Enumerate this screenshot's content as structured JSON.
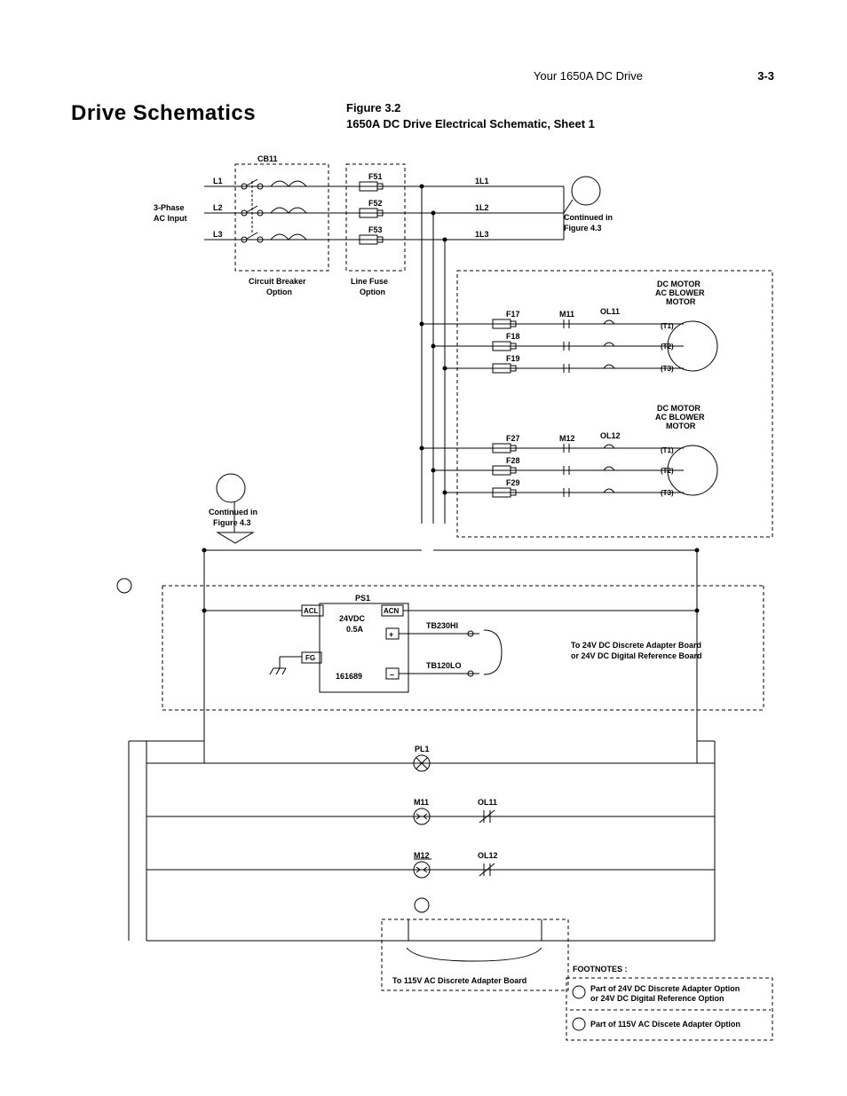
{
  "header": {
    "doc_title": "Your 1650A DC Drive",
    "page_no": "3-3"
  },
  "section": "Drive Schematics",
  "figure": {
    "num": "Figure 3.2",
    "caption": "1650A DC Drive Electrical Schematic, Sheet 1"
  },
  "ac_input": {
    "label1": "3-Phase",
    "label2": "AC Input",
    "L1": "L1",
    "L2": "L2",
    "L3": "L3"
  },
  "cb": {
    "name": "CB11",
    "opt1": "Circuit Breaker",
    "opt2": "Option"
  },
  "lf": {
    "opt1": "Line Fuse",
    "opt2": "Option"
  },
  "fuses_top": {
    "F51": "F51",
    "F52": "F52",
    "F53": "F53"
  },
  "bus": {
    "L1": "1L1",
    "L2": "1L2",
    "L3": "1L3"
  },
  "cont_top": {
    "l1": "Continued in",
    "l2": "Figure 4.3"
  },
  "cont_left": {
    "l1": "Continued in",
    "l2": "Figure 4.3"
  },
  "motor1": {
    "title1": "DC MOTOR",
    "title2": "AC BLOWER",
    "title3": "MOTOR",
    "F": "F17",
    "F2": "F18",
    "F3": "F19",
    "M": "M11",
    "OL": "OL11",
    "T1": "(T1)",
    "T2": "(T2)",
    "T3": "(T3)"
  },
  "motor2": {
    "title1": "DC MOTOR",
    "title2": "AC BLOWER",
    "title3": "MOTOR",
    "F": "F27",
    "F2": "F28",
    "F3": "F29",
    "M": "M12",
    "OL": "OL12",
    "T1": "(T1)",
    "T2": "(T2)",
    "T3": "(T3)"
  },
  "ps": {
    "name": "PS1",
    "acl": "ACL",
    "acn": "ACN",
    "fg": "FG",
    "v": "24VDC",
    "a": "0.5A",
    "pn": "161689",
    "hi": "TB230HI",
    "lo": "TB120LO",
    "out1": "To 24V DC Discrete Adapter Board",
    "out2": "or 24V DC Digital Reference Board"
  },
  "ladder": {
    "PL1": "PL1",
    "M11": "M11",
    "OL11": "OL11",
    "M12": "M12",
    "OL12": "OL12"
  },
  "bottom": {
    "note": "To 115V AC Discrete Adapter Board"
  },
  "footnotes": {
    "title": "FOOTNOTES :",
    "n1a": "Part of 24V DC Discrete Adapter Option",
    "n1b": "or 24V DC Digital Reference Option",
    "n2": "Part of 115V AC Discete Adapter Option"
  }
}
